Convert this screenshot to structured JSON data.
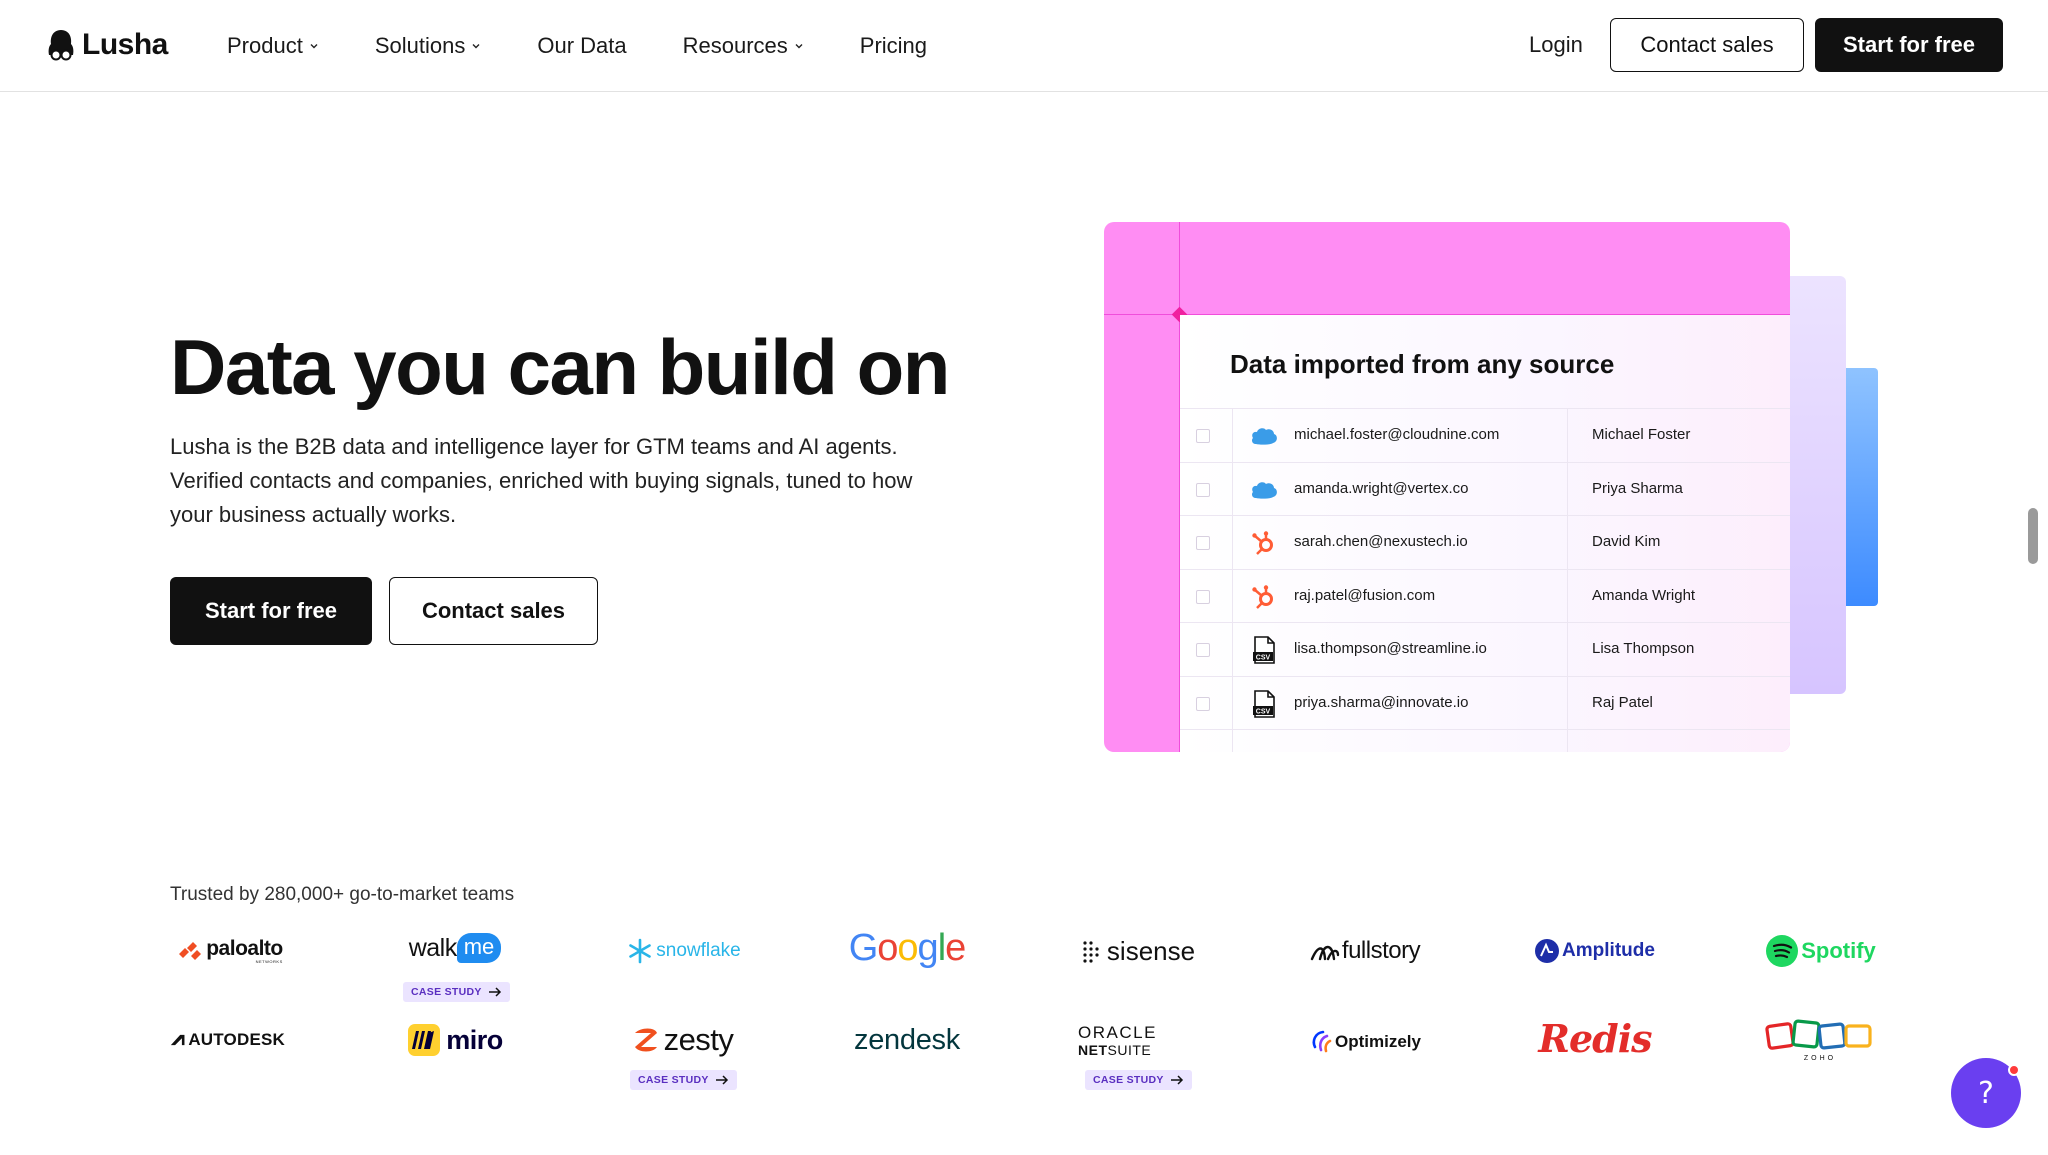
{
  "header": {
    "brand": "Lusha",
    "nav": [
      {
        "label": "Product",
        "has_dropdown": true
      },
      {
        "label": "Solutions",
        "has_dropdown": true
      },
      {
        "label": "Our Data",
        "has_dropdown": false
      },
      {
        "label": "Resources",
        "has_dropdown": true
      },
      {
        "label": "Pricing",
        "has_dropdown": false
      }
    ],
    "login": "Login",
    "contact_sales": "Contact sales",
    "start_free": "Start for free"
  },
  "hero": {
    "title": "Data you can build on",
    "description": "Lusha is the B2B data and intelligence layer for GTM teams and AI agents. Verified contacts and companies, enriched with buying signals, tuned to how your business actually works.",
    "primary_cta": "Start for free",
    "secondary_cta": "Contact sales"
  },
  "card": {
    "title": "Data imported from any source",
    "rows": [
      {
        "source_icon": "salesforce-icon",
        "email": "michael.foster@cloudnine.com",
        "name": "Michael Foster"
      },
      {
        "source_icon": "salesforce-icon",
        "email": "amanda.wright@vertex.co",
        "name": "Priya Sharma"
      },
      {
        "source_icon": "hubspot-icon",
        "email": "sarah.chen@nexustech.io",
        "name": "David Kim"
      },
      {
        "source_icon": "hubspot-icon",
        "email": "raj.patel@fusion.com",
        "name": "Amanda Wright"
      },
      {
        "source_icon": "csv-file-icon",
        "email": "lisa.thompson@streamline.io",
        "name": "Lisa Thompson"
      },
      {
        "source_icon": "csv-file-icon",
        "email": "priya.sharma@innovate.io",
        "name": "Raj Patel"
      }
    ],
    "csv_label": "CSV"
  },
  "trusted": {
    "text": "Trusted by 280,000+ go-to-market teams",
    "case_study_label": "CASE STUDY",
    "logos": {
      "paloalto": "paloalto",
      "paloalto_sub": "NETWORKS",
      "walkme_a": "walk",
      "walkme_b": "me",
      "snowflake": "snowflake",
      "google": [
        "G",
        "o",
        "o",
        "g",
        "l",
        "e"
      ],
      "sisense": "sisense",
      "fullstory": "fullstory",
      "amplitude": "Amplitude",
      "spotify": "Spotify",
      "autodesk": "AUTODESK",
      "miro": "miro",
      "zesty": "zesty",
      "zendesk": "zendesk",
      "oracle": "ORACLE",
      "netsuite_a": "NET",
      "netsuite_b": "SUITE",
      "optimizely": "Optimizely",
      "redis": "Redis",
      "zoho": "ZOHO"
    }
  },
  "colors": {
    "card_pink": "#ff8df3",
    "accent_purple": "#6a3ff0",
    "primary_dark": "#111111"
  },
  "help": {
    "icon": "question-icon",
    "glyph": "?"
  }
}
